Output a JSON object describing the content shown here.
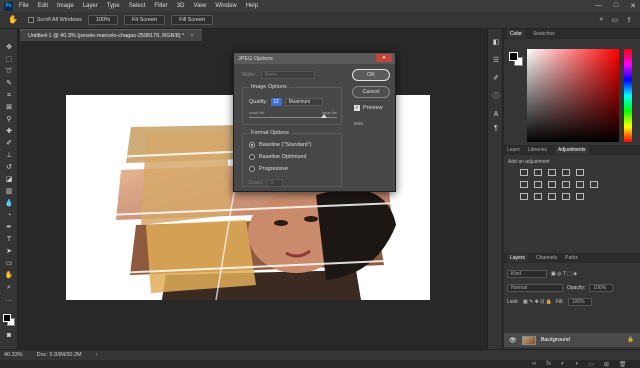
{
  "app": {
    "logo": "Ps"
  },
  "menu": [
    "File",
    "Edit",
    "Image",
    "Layer",
    "Type",
    "Select",
    "Filter",
    "3D",
    "View",
    "Window",
    "Help"
  ],
  "window_controls": [
    "—",
    "□",
    "✕"
  ],
  "options_bar": {
    "scroll_all_label": "Scroll All Windows",
    "zoom_value": "100%",
    "fit_screen": "Fit Screen",
    "fill_screen": "Fill Screen"
  },
  "document_tab": {
    "title": "Untitled-1 @ 40.3% (pexels-marcelo-chagas-2598179, RGB/8) *",
    "close": "×"
  },
  "status": {
    "zoom": "40.33%",
    "doc": "Doc: 5.93M/30.2M"
  },
  "right_panel": {
    "color_tabs": [
      "Color",
      "Swatches"
    ],
    "adj_tabs": [
      "Learn",
      "Libraries",
      "Adjustments"
    ],
    "adj_title": "Add an adjustment",
    "layer_tabs": [
      "Layers",
      "Channels",
      "Paths"
    ],
    "layer_filter": "Kind",
    "blend_mode": "Normal",
    "opacity_label": "Opacity:",
    "opacity_value": "100%",
    "lock_label": "Lock:",
    "fill_label": "Fill:",
    "fill_value": "100%",
    "layer_name": "Background"
  },
  "dialog": {
    "title": "JPEG Options",
    "matte_label": "Matte:",
    "matte_value": "None",
    "image_options_label": "Image Options",
    "quality_label": "Quality:",
    "quality_value": "12",
    "quality_preset": "Maximum",
    "small_file": "small file",
    "large_file": "large file",
    "format_options_label": "Format Options",
    "formats": [
      "Baseline (\"Standard\")",
      "Baseline Optimized",
      "Progressive"
    ],
    "selected_format_index": 0,
    "scans_label": "Scans:",
    "scans_value": "3",
    "ok_label": "OK",
    "cancel_label": "Cancel",
    "preview_label": "Preview",
    "preview_checked": true,
    "file_size": "5MB"
  }
}
